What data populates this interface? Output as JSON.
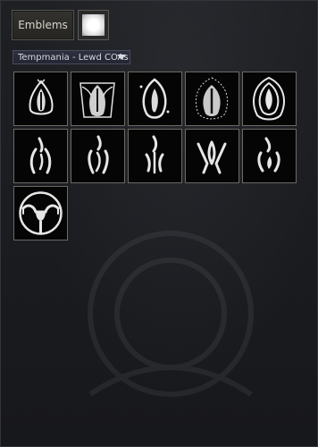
{
  "tab": {
    "label": "Emblems"
  },
  "selector": {
    "selected": "Tempmania - Lewd COAs"
  },
  "emblems": [
    {
      "icon": "emblem-1-icon"
    },
    {
      "icon": "emblem-2-icon"
    },
    {
      "icon": "emblem-3-icon"
    },
    {
      "icon": "emblem-4-icon"
    },
    {
      "icon": "emblem-5-icon"
    },
    {
      "icon": "emblem-6-icon"
    },
    {
      "icon": "emblem-7-icon"
    },
    {
      "icon": "emblem-8-icon"
    },
    {
      "icon": "emblem-9-icon"
    },
    {
      "icon": "emblem-10-icon"
    },
    {
      "icon": "emblem-11-icon"
    }
  ]
}
